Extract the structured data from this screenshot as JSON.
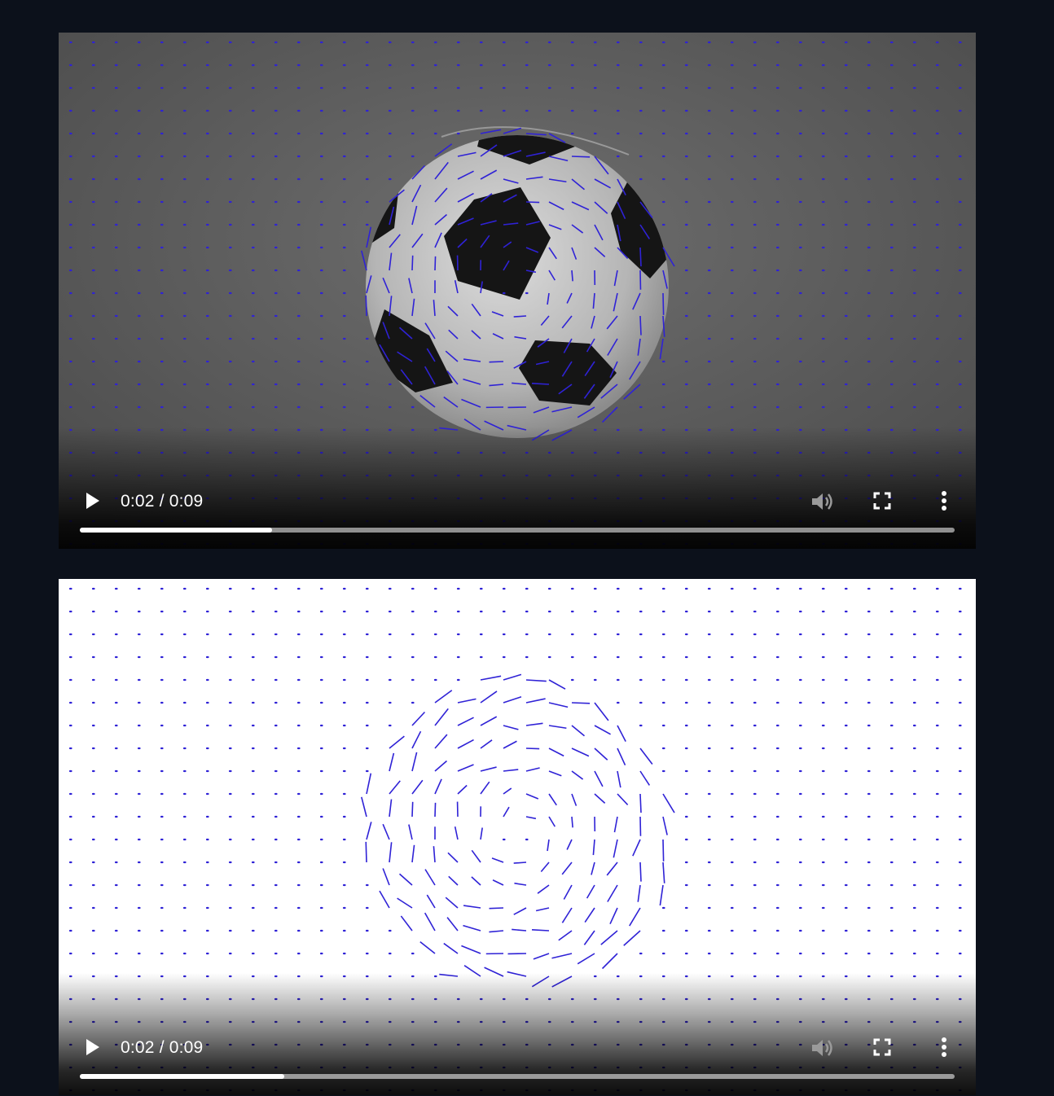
{
  "players": [
    {
      "name": "video-player-original",
      "current_time": "0:02",
      "separator": "/",
      "duration": "0:09",
      "progress": 0.22,
      "background": "#5b5b5b",
      "content": "soccer ball with blue optical-flow vectors"
    },
    {
      "name": "video-player-flow",
      "current_time": "0:02",
      "separator": "/",
      "duration": "0:09",
      "progress": 0.234,
      "background": "#ffffff",
      "content": "blue optical-flow vector field"
    }
  ],
  "colors": {
    "page_background": "#0c111b",
    "flow_vector": "#2f22d6",
    "controls_text": "#ffffff"
  },
  "icons": [
    "play-icon",
    "volume-icon",
    "fullscreen-icon",
    "more-options-icon"
  ]
}
